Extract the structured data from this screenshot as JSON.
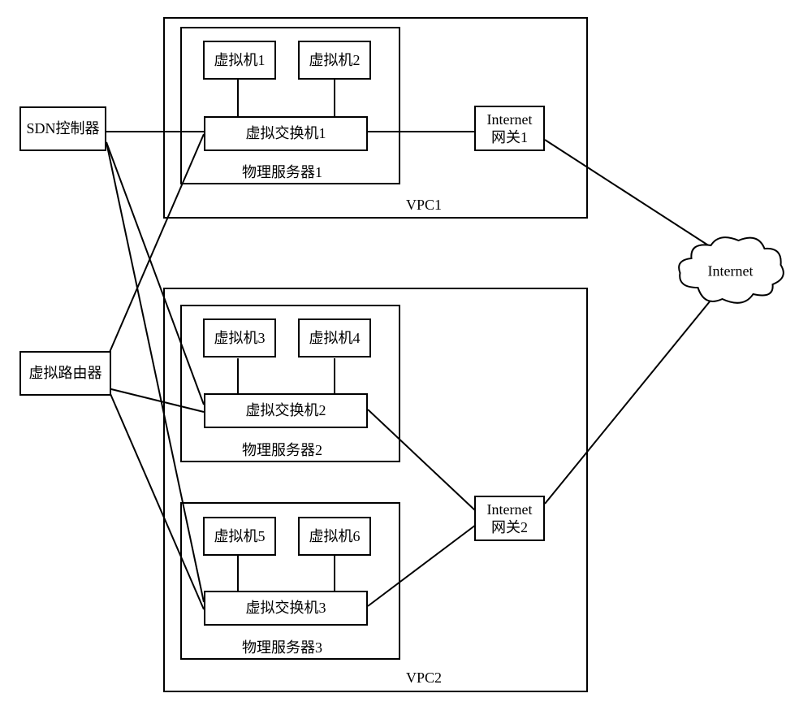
{
  "nodes": {
    "sdn": "SDN控制器",
    "vrouter": "虚拟路由器",
    "vm1": "虚拟机1",
    "vm2": "虚拟机2",
    "vm3": "虚拟机3",
    "vm4": "虚拟机4",
    "vm5": "虚拟机5",
    "vm6": "虚拟机6",
    "vswitch1": "虚拟交换机1",
    "vswitch2": "虚拟交换机2",
    "vswitch3": "虚拟交换机3",
    "phys1": "物理服务器1",
    "phys2": "物理服务器2",
    "phys3": "物理服务器3",
    "gw1": "Internet\n网关1",
    "gw2": "Internet\n网关2",
    "internet": "Internet",
    "vpc1": "VPC1",
    "vpc2": "VPC2"
  },
  "chart_data": {
    "type": "diagram",
    "title": "",
    "description": "SDN/VPC network topology with physical servers, virtual switches, virtual machines, internet gateways, and a virtual router.",
    "nodes": [
      {
        "id": "sdn",
        "label": "SDN控制器",
        "type": "controller"
      },
      {
        "id": "vrouter",
        "label": "虚拟路由器",
        "type": "router"
      },
      {
        "id": "vpc1",
        "label": "VPC1",
        "type": "vpc",
        "children": [
          "phys1",
          "gw1"
        ]
      },
      {
        "id": "vpc2",
        "label": "VPC2",
        "type": "vpc",
        "children": [
          "phys2",
          "phys3",
          "gw2"
        ]
      },
      {
        "id": "phys1",
        "label": "物理服务器1",
        "type": "server",
        "children": [
          "vm1",
          "vm2",
          "vswitch1"
        ]
      },
      {
        "id": "phys2",
        "label": "物理服务器2",
        "type": "server",
        "children": [
          "vm3",
          "vm4",
          "vswitch2"
        ]
      },
      {
        "id": "phys3",
        "label": "物理服务器3",
        "type": "server",
        "children": [
          "vm5",
          "vm6",
          "vswitch3"
        ]
      },
      {
        "id": "vm1",
        "label": "虚拟机1",
        "type": "vm"
      },
      {
        "id": "vm2",
        "label": "虚拟机2",
        "type": "vm"
      },
      {
        "id": "vm3",
        "label": "虚拟机3",
        "type": "vm"
      },
      {
        "id": "vm4",
        "label": "虚拟机4",
        "type": "vm"
      },
      {
        "id": "vm5",
        "label": "虚拟机5",
        "type": "vm"
      },
      {
        "id": "vm6",
        "label": "虚拟机6",
        "type": "vm"
      },
      {
        "id": "vswitch1",
        "label": "虚拟交换机1",
        "type": "vswitch"
      },
      {
        "id": "vswitch2",
        "label": "虚拟交换机2",
        "type": "vswitch"
      },
      {
        "id": "vswitch3",
        "label": "虚拟交换机3",
        "type": "vswitch"
      },
      {
        "id": "gw1",
        "label": "Internet网关1",
        "type": "gateway"
      },
      {
        "id": "gw2",
        "label": "Internet网关2",
        "type": "gateway"
      },
      {
        "id": "internet",
        "label": "Internet",
        "type": "cloud"
      }
    ],
    "edges": [
      {
        "from": "sdn",
        "to": "vswitch1"
      },
      {
        "from": "sdn",
        "to": "vswitch2"
      },
      {
        "from": "sdn",
        "to": "vswitch3"
      },
      {
        "from": "vrouter",
        "to": "vswitch1"
      },
      {
        "from": "vrouter",
        "to": "vswitch2"
      },
      {
        "from": "vrouter",
        "to": "vswitch3"
      },
      {
        "from": "vm1",
        "to": "vswitch1"
      },
      {
        "from": "vm2",
        "to": "vswitch1"
      },
      {
        "from": "vswitch1",
        "to": "gw1"
      },
      {
        "from": "gw1",
        "to": "internet"
      },
      {
        "from": "vm3",
        "to": "vswitch2"
      },
      {
        "from": "vm4",
        "to": "vswitch2"
      },
      {
        "from": "vm5",
        "to": "vswitch3"
      },
      {
        "from": "vm6",
        "to": "vswitch3"
      },
      {
        "from": "vswitch2",
        "to": "gw2"
      },
      {
        "from": "vswitch3",
        "to": "gw2"
      },
      {
        "from": "gw2",
        "to": "internet"
      }
    ]
  }
}
